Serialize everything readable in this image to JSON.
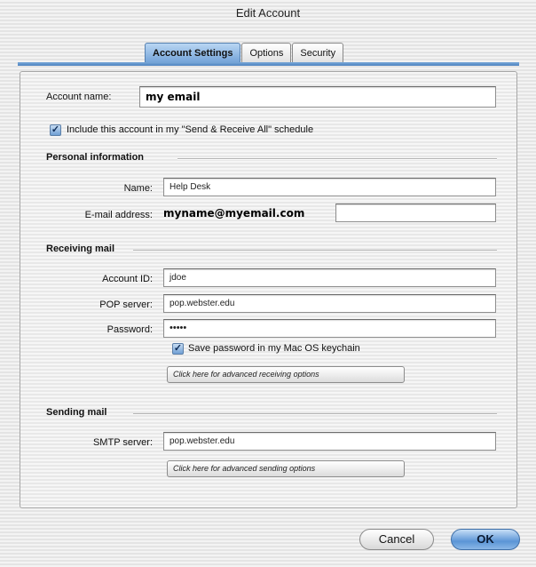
{
  "window": {
    "title": "Edit Account"
  },
  "tabs": [
    {
      "label": "Account Settings",
      "active": true
    },
    {
      "label": "Options",
      "active": false
    },
    {
      "label": "Security",
      "active": false
    }
  ],
  "account": {
    "name_label": "Account name:",
    "name_value": "my email",
    "include_checked": true,
    "include_label": "Include this account in my \"Send & Receive All\" schedule"
  },
  "personal": {
    "heading": "Personal information",
    "name_label": "Name:",
    "name_value": "Help Desk",
    "email_label": "E-mail address:",
    "email_value": "myname@myemail.com"
  },
  "receiving": {
    "heading": "Receiving mail",
    "account_id_label": "Account ID:",
    "account_id_value": "jdoe",
    "pop_label": "POP server:",
    "pop_value": "pop.webster.edu",
    "password_label": "Password:",
    "password_value": "•••••",
    "save_pw_checked": true,
    "save_pw_label": "Save password in my Mac OS keychain",
    "advanced_label": "Click here for advanced receiving options"
  },
  "sending": {
    "heading": "Sending mail",
    "smtp_label": "SMTP server:",
    "smtp_value": "pop.webster.edu",
    "advanced_label": "Click here for advanced sending options"
  },
  "buttons": {
    "cancel": "Cancel",
    "ok": "OK"
  },
  "colors": {
    "accent": "#6e9fd6",
    "tab_line": "#5b8fca",
    "ok_button": "#5b95d6"
  }
}
